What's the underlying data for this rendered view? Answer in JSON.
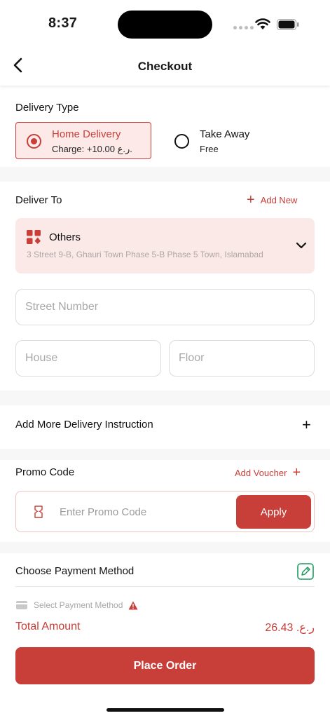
{
  "status_bar": {
    "time": "8:37"
  },
  "header": {
    "title": "Checkout"
  },
  "delivery_type": {
    "title": "Delivery Type",
    "options": [
      {
        "label": "Home Delivery",
        "sub": "Charge: +10.00 ر.ع.",
        "selected": true
      },
      {
        "label": "Take Away",
        "sub": "Free",
        "selected": false
      }
    ]
  },
  "deliver_to": {
    "title": "Deliver To",
    "add_new_label": "Add New",
    "address": {
      "type": "Others",
      "text": "3 Street 9-B, Ghauri Town Phase 5-B Phase 5 Town, Islamabad"
    }
  },
  "address_fields": {
    "street_placeholder": "Street Number",
    "house_placeholder": "House",
    "floor_placeholder": "Floor"
  },
  "instructions": {
    "label": "Add More Delivery Instruction"
  },
  "promo": {
    "title": "Promo Code",
    "add_voucher_label": "Add Voucher",
    "input_placeholder": "Enter Promo Code",
    "apply_label": "Apply"
  },
  "payment": {
    "title": "Choose Payment Method",
    "select_label": "Select Payment Method"
  },
  "summary": {
    "total_label": "Total Amount",
    "total_value": "ر.ع. 26.43",
    "place_order_label": "Place Order"
  },
  "colors": {
    "accent": "#c83e38",
    "accent_light": "#fce9e8"
  }
}
